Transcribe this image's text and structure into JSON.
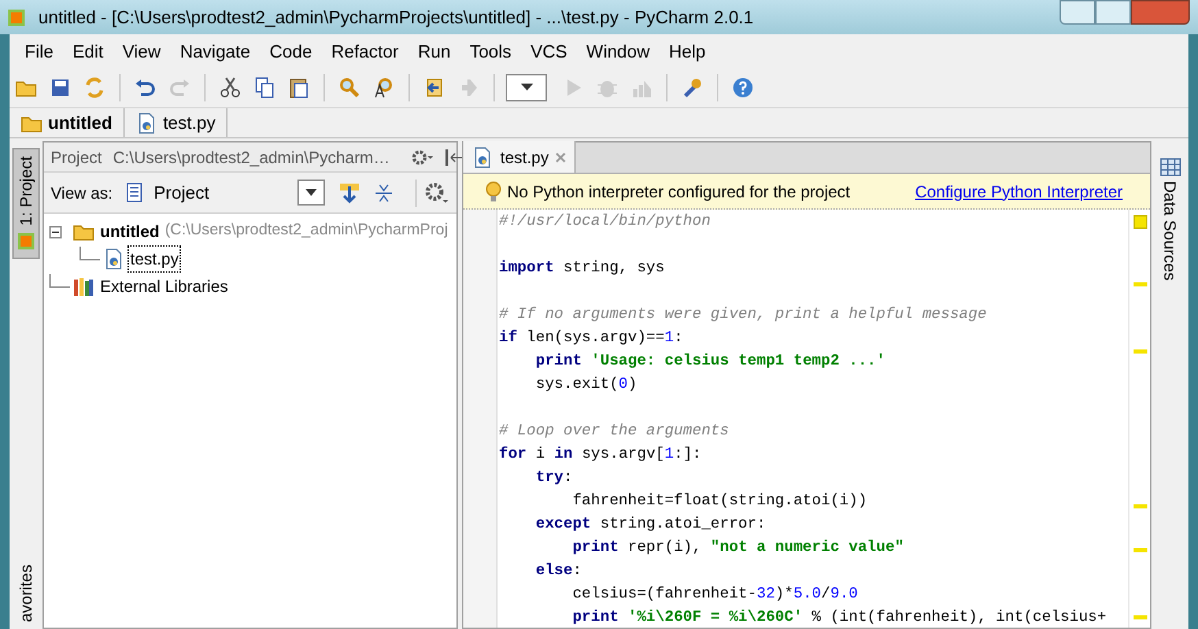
{
  "window": {
    "title": "untitled - [C:\\Users\\prodtest2_admin\\PycharmProjects\\untitled] - ...\\test.py - PyCharm 2.0.1"
  },
  "menu": [
    "File",
    "Edit",
    "View",
    "Navigate",
    "Code",
    "Refactor",
    "Run",
    "Tools",
    "VCS",
    "Window",
    "Help"
  ],
  "toolbar": [
    {
      "kind": "open",
      "disabled": false
    },
    {
      "kind": "save",
      "disabled": false
    },
    {
      "kind": "sync",
      "disabled": false
    },
    {
      "kind": "sep"
    },
    {
      "kind": "undo",
      "disabled": false
    },
    {
      "kind": "redo",
      "disabled": true
    },
    {
      "kind": "sep"
    },
    {
      "kind": "cut",
      "disabled": false
    },
    {
      "kind": "copy",
      "disabled": false
    },
    {
      "kind": "paste",
      "disabled": false
    },
    {
      "kind": "sep"
    },
    {
      "kind": "find",
      "disabled": false
    },
    {
      "kind": "replace",
      "disabled": false
    },
    {
      "kind": "sep"
    },
    {
      "kind": "back",
      "disabled": false
    },
    {
      "kind": "forward",
      "disabled": true
    },
    {
      "kind": "sep"
    },
    {
      "kind": "combo"
    },
    {
      "kind": "run",
      "disabled": true
    },
    {
      "kind": "debug",
      "disabled": true
    },
    {
      "kind": "profile",
      "disabled": true
    },
    {
      "kind": "sep"
    },
    {
      "kind": "settings",
      "disabled": false
    },
    {
      "kind": "sep"
    },
    {
      "kind": "help",
      "disabled": false
    }
  ],
  "breadcrumbs": [
    {
      "label": "untitled",
      "kind": "folder"
    },
    {
      "label": "test.py",
      "kind": "file"
    }
  ],
  "left_strip": [
    {
      "label": "1: Project",
      "selected": true
    },
    {
      "label": "avorites",
      "selected": false
    }
  ],
  "project_panel": {
    "title": "Project",
    "path": "C:\\Users\\prodtest2_admin\\Pycharm…",
    "view_as_label": "View as:",
    "view_as_value": "Project",
    "tree": [
      {
        "label": "untitled",
        "detail": "(C:\\Users\\prodtest2_admin\\PycharmProj",
        "kind": "folder",
        "expanded": true,
        "selected": false,
        "children": [
          {
            "label": "test.py",
            "kind": "file",
            "selected": true
          }
        ]
      },
      {
        "label": "External Libraries",
        "kind": "library",
        "selected": false
      }
    ]
  },
  "editor": {
    "tabs": [
      {
        "label": "test.py",
        "selected": true
      }
    ],
    "notice": {
      "text": "No Python interpreter configured for the project",
      "link": "Configure Python Interpreter"
    },
    "lines": [
      {
        "tokens": [
          {
            "kind": "comment",
            "text": "#!/usr/local/bin/python"
          }
        ]
      },
      {
        "blank": true
      },
      {
        "marker": true,
        "tokens": [
          {
            "kind": "kw",
            "text": "import"
          },
          {
            "kind": "plain",
            "text": " string, sys"
          }
        ]
      },
      {
        "blank": true
      },
      {
        "tokens": [
          {
            "kind": "comment",
            "text": "# If no arguments were given, print a helpful message"
          }
        ]
      },
      {
        "marker": true,
        "tokens": [
          {
            "kind": "kw",
            "text": "if"
          },
          {
            "kind": "plain",
            "text": " len(sys.argv)=="
          },
          {
            "kind": "num",
            "text": "1"
          },
          {
            "kind": "plain",
            "text": ":"
          }
        ]
      },
      {
        "tokens": [
          {
            "kind": "kw",
            "text": "    print"
          },
          {
            "kind": "str",
            "text": " 'Usage: celsius temp1 temp2 ...'"
          }
        ]
      },
      {
        "tokens": [
          {
            "kind": "plain",
            "text": "    sys.exit("
          },
          {
            "kind": "num",
            "text": "0"
          },
          {
            "kind": "plain",
            "text": ")"
          }
        ]
      },
      {
        "blank": true
      },
      {
        "tokens": [
          {
            "kind": "comment",
            "text": "# Loop over the arguments"
          }
        ]
      },
      {
        "tokens": [
          {
            "kind": "kw",
            "text": "for"
          },
          {
            "kind": "plain",
            "text": " i "
          },
          {
            "kind": "kw",
            "text": "in"
          },
          {
            "kind": "plain",
            "text": " sys.argv["
          },
          {
            "kind": "num",
            "text": "1"
          },
          {
            "kind": "plain",
            "text": ":]:"
          }
        ]
      },
      {
        "tokens": [
          {
            "kind": "kw",
            "text": "    try"
          },
          {
            "kind": "plain",
            "text": ":"
          }
        ]
      },
      {
        "marker": true,
        "tokens": [
          {
            "kind": "plain",
            "text": "        fahrenheit=float(string.atoi(i))"
          }
        ]
      },
      {
        "tokens": [
          {
            "kind": "kw",
            "text": "    except"
          },
          {
            "kind": "plain",
            "text": " string.atoi_error:"
          }
        ]
      },
      {
        "marker": true,
        "tokens": [
          {
            "kind": "kw",
            "text": "        print"
          },
          {
            "kind": "plain",
            "text": " repr(i), "
          },
          {
            "kind": "str",
            "text": "\"not a numeric value\""
          }
        ]
      },
      {
        "tokens": [
          {
            "kind": "kw",
            "text": "    else"
          },
          {
            "kind": "plain",
            "text": ":"
          }
        ]
      },
      {
        "tokens": [
          {
            "kind": "plain",
            "text": "        celsius=(fahrenheit-"
          },
          {
            "kind": "num",
            "text": "32"
          },
          {
            "kind": "plain",
            "text": ")*"
          },
          {
            "kind": "num",
            "text": "5.0"
          },
          {
            "kind": "plain",
            "text": "/"
          },
          {
            "kind": "num",
            "text": "9.0"
          }
        ]
      },
      {
        "marker": true,
        "tokens": [
          {
            "kind": "kw",
            "text": "        print"
          },
          {
            "kind": "str",
            "text": " '%i\\260F = %i\\260C'"
          },
          {
            "kind": "plain",
            "text": " % (int(fahrenheit), int(celsius+"
          }
        ]
      }
    ]
  },
  "right_strip": [
    {
      "label": "Data Sources",
      "selected": false
    }
  ]
}
